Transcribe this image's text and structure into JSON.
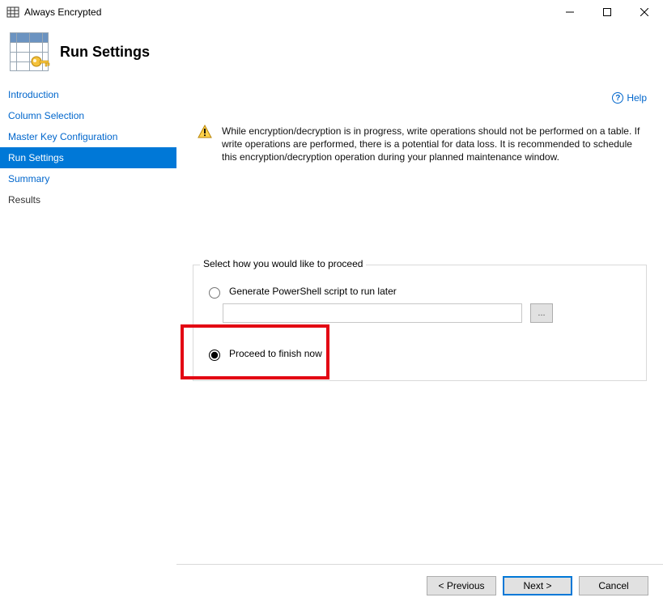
{
  "window": {
    "title": "Always Encrypted"
  },
  "header": {
    "title": "Run Settings"
  },
  "help": {
    "label": "Help"
  },
  "sidebar": {
    "items": [
      {
        "label": "Introduction"
      },
      {
        "label": "Column Selection"
      },
      {
        "label": "Master Key Configuration"
      },
      {
        "label": "Run Settings"
      },
      {
        "label": "Summary"
      },
      {
        "label": "Results"
      }
    ],
    "activeIndex": 3
  },
  "warning": {
    "text": "While encryption/decryption is in progress, write operations should not be performed on a table. If write operations are performed, there is a potential for data loss. It is recommended to schedule this encryption/decryption operation during your planned maintenance window."
  },
  "proceed": {
    "legend": "Select how you would like to proceed",
    "optionScript": "Generate PowerShell script to run later",
    "optionNow": "Proceed to finish now",
    "scriptPath": "",
    "browseLabel": "...",
    "selected": "now"
  },
  "footer": {
    "previous": "< Previous",
    "next": "Next >",
    "cancel": "Cancel"
  }
}
